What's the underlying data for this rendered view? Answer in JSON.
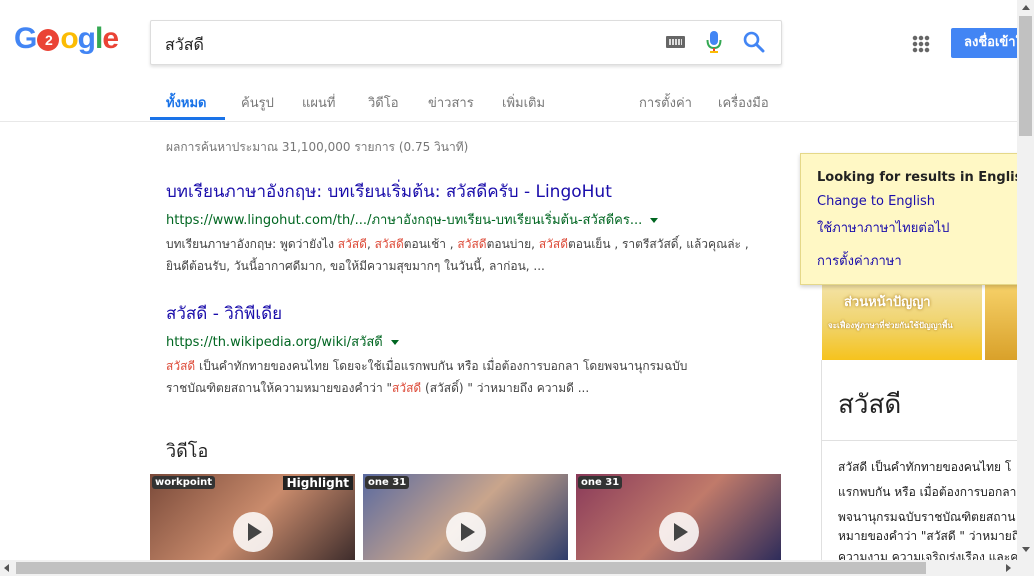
{
  "logo": {
    "text": "G2ogle"
  },
  "search": {
    "query": "สวัสดี"
  },
  "header": {
    "signin_label": "ลงชื่อเข้าใช้"
  },
  "tabs": [
    {
      "label": "ทั้งหมด",
      "active": true
    },
    {
      "label": "ค้นรูป"
    },
    {
      "label": "แผนที่"
    },
    {
      "label": "วิดีโอ"
    },
    {
      "label": "ข่าวสาร"
    },
    {
      "label": "เพิ่มเติม"
    },
    {
      "label": "การตั้งค่า"
    },
    {
      "label": "เครื่องมือ"
    }
  ],
  "stats": "ผลการค้นหาประมาณ 31,100,000 รายการ (0.75 วินาที)",
  "results": [
    {
      "title": "บทเรียนภาษาอังกฤษ: บทเรียนเริ่มต้น: สวัสดีครับ - LingoHut",
      "url": "https://www.lingohut.com/th/.../ภาษาอังกฤษ-บทเรียน-บทเรียนเริ่มต้น-สวัสดีคร...",
      "snippet_line1": [
        {
          "t": "บทเรียนภาษาอังกฤษ: พูดว่ายังไง ",
          "em": false
        },
        {
          "t": "สวัสดี",
          "em": true
        },
        {
          "t": ", ",
          "em": false
        },
        {
          "t": "สวัสดี",
          "em": true
        },
        {
          "t": "ตอนเช้า , ",
          "em": false
        },
        {
          "t": "สวัสดี",
          "em": true
        },
        {
          "t": "ตอนบ่าย, ",
          "em": false
        },
        {
          "t": "สวัสดี",
          "em": true
        },
        {
          "t": "ตอนเย็น , ราตรีสวัสดิ์, แล้วคุณล่ะ ,",
          "em": false
        }
      ],
      "snippet_line2": "ยินดีต้อนรับ, วันนี้อากาศดีมาก, ขอให้มีความสุขมากๆ ในวันนี้, ลาก่อน, ..."
    },
    {
      "title": "สวัสดี - วิกิพีเดีย",
      "url": "https://th.wikipedia.org/wiki/สวัสดี",
      "snippet_line1": [
        {
          "t": "สวัสดี",
          "em": true
        },
        {
          "t": " เป็นคำทักทายของคนไทย โดยจะใช้เมื่อแรกพบกัน หรือ เมื่อต้องการบอกลา โดยพจนานุกรมฉบับ",
          "em": false
        }
      ],
      "snippet_line2_parts": [
        {
          "t": "ราชบัณฑิตยสถานให้ความหมายของคำว่า \"",
          "em": false
        },
        {
          "t": "สวัสดี",
          "em": true
        },
        {
          "t": " (สวัสดิ์) \" ว่าหมายถึง ความดี ...",
          "em": false
        }
      ]
    }
  ],
  "videos": {
    "heading": "วิดีโอ",
    "items": [
      {
        "badge": "workpoint",
        "highlight": "Highlight",
        "colors": [
          "#7a4a3a",
          "#c98b6c",
          "#3a2a2a"
        ]
      },
      {
        "badge": "one 31",
        "highlight": "",
        "colors": [
          "#5a6aa0",
          "#c9a58c",
          "#2a3a6a"
        ]
      },
      {
        "badge": "one 31",
        "highlight": "",
        "colors": [
          "#8a3a5a",
          "#c07a6a",
          "#2a2a5a"
        ]
      }
    ]
  },
  "language_box": {
    "title": "Looking for results in English?",
    "link1": "Change to English",
    "link2": "ใช้ภาษาภาษาไทยต่อไป",
    "link3": "การตั้งค่าภาษา"
  },
  "knowledge_panel": {
    "title": "สวัสดี",
    "image_caption": "ส่วนหน้าปัญญา",
    "image_caption2": "จะเฟื่องฟูภาษาที่ช่วยกันใช้ปัญญาพื้น",
    "lines": [
      "สวัสดี เป็นคำทักทายของคนไทย โ",
      "แรกพบกัน หรือ เมื่อต้องการบอกลา",
      "พจนานุกรมฉบับราชบัณฑิตยสถาน",
      "หมายของคำว่า \"สวัสดี \" ว่าหมายถึ",
      "ความงาม ความเจริญรุ่งเรือง และค"
    ]
  },
  "colors": {
    "link": "#1a0dab",
    "url": "#006621",
    "accent": "#1a73e8",
    "emphasis": "#dd4b39"
  }
}
